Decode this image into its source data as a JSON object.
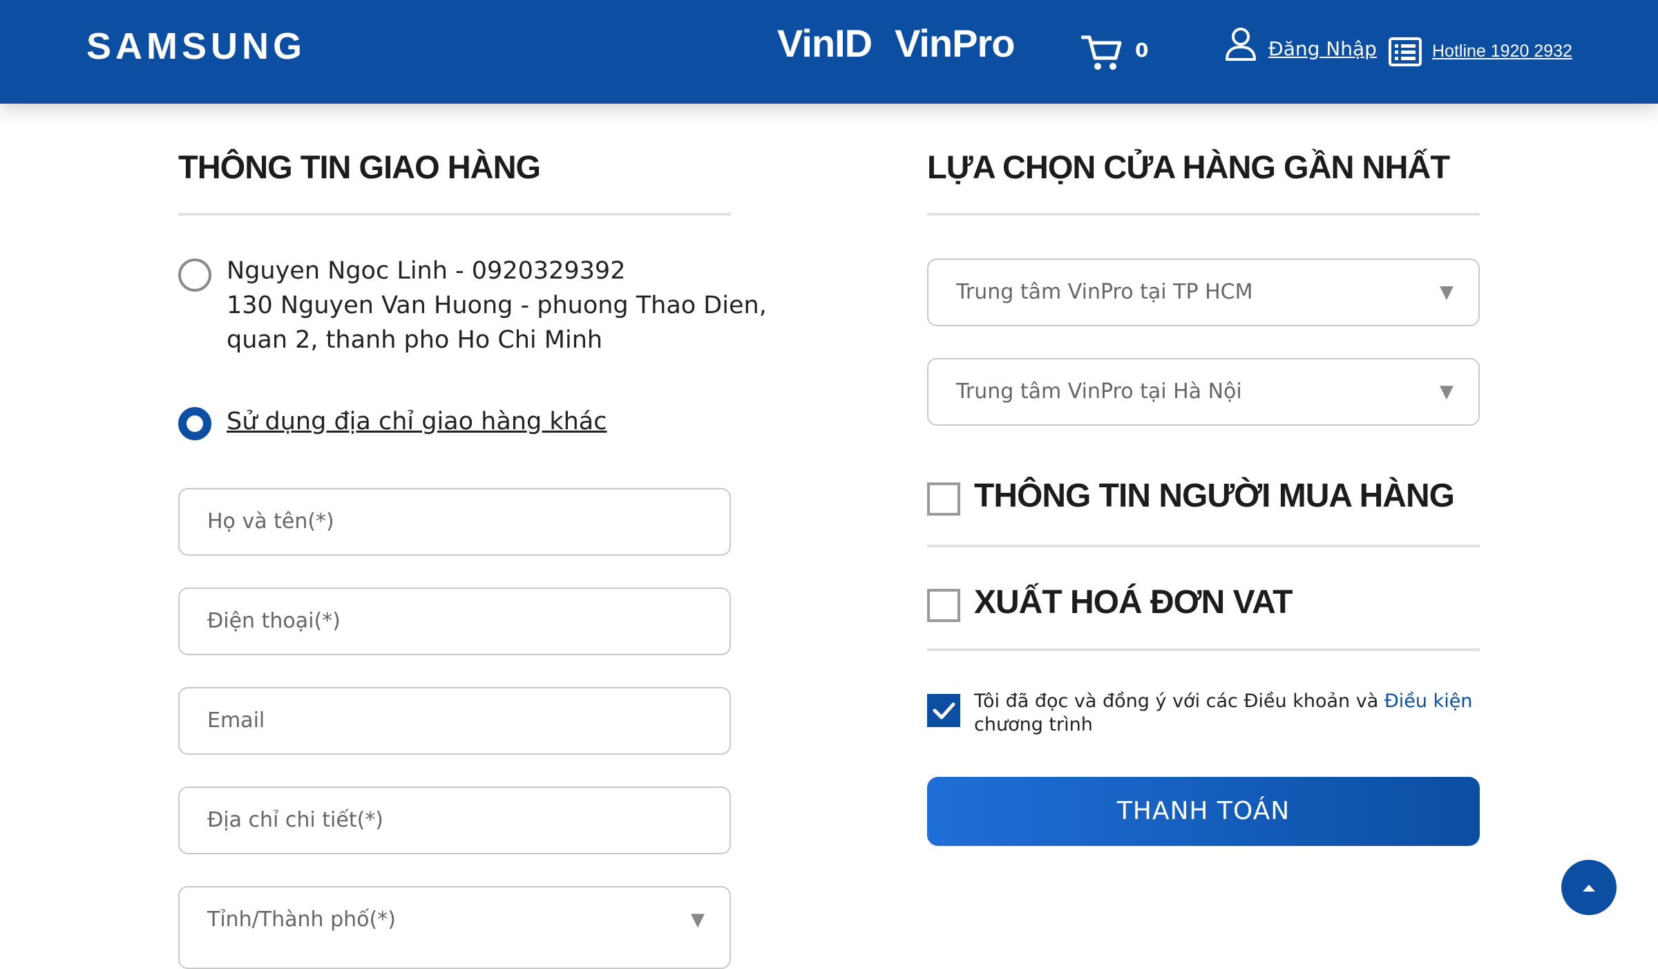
{
  "header": {
    "logo": "SAMSUNG",
    "brand_vinid": "VinID",
    "brand_vinpro": "VinPro",
    "cart_count": "0",
    "login_label": "Đăng Nhập",
    "hotline_label": "Hotline 1920 2932",
    "icons": [
      "cart-icon",
      "user-icon",
      "list-icon"
    ],
    "background_color": "#0b4ea2"
  },
  "shipping": {
    "title": "THÔNG TIN GIAO HÀNG",
    "saved_address": {
      "line1": "Nguyen Ngoc Linh - 0920329392",
      "line2": "130 Nguyen Van Huong - phuong Thao Dien,",
      "line3": "quan 2, thanh pho Ho Chi Minh",
      "selected": false
    },
    "other_address": {
      "label": "Sử dụng địa chỉ giao hàng khác",
      "selected": true
    },
    "fields": {
      "name_placeholder": "Họ và tên(*)",
      "phone_placeholder": "Điện thoại(*)",
      "email_placeholder": "Email",
      "address_placeholder": "Địa chỉ chi tiết(*)",
      "city_placeholder": "Tỉnh/Thành phố(*)"
    }
  },
  "store": {
    "title": "LỰA CHỌN CỬA HÀNG GẦN NHẤT",
    "select_hcm": "Trung tâm VinPro tại TP HCM",
    "select_hanoi": "Trung tâm VinPro tại Hà Nội"
  },
  "buyer_info": {
    "label": "THÔNG TIN NGƯỜI MUA HÀNG",
    "checked": false
  },
  "vat_invoice": {
    "label": "XUẤT HOÁ ĐƠN VAT",
    "checked": false
  },
  "terms": {
    "text_before": "Tôi đã đọc và đồng ý với các Điều khoản và ",
    "link_text": "Điều kiện",
    "text_after": " chương trình",
    "checked": true
  },
  "pay_button_label": "THANH TOÁN",
  "accent_color": "#0b4ea2"
}
